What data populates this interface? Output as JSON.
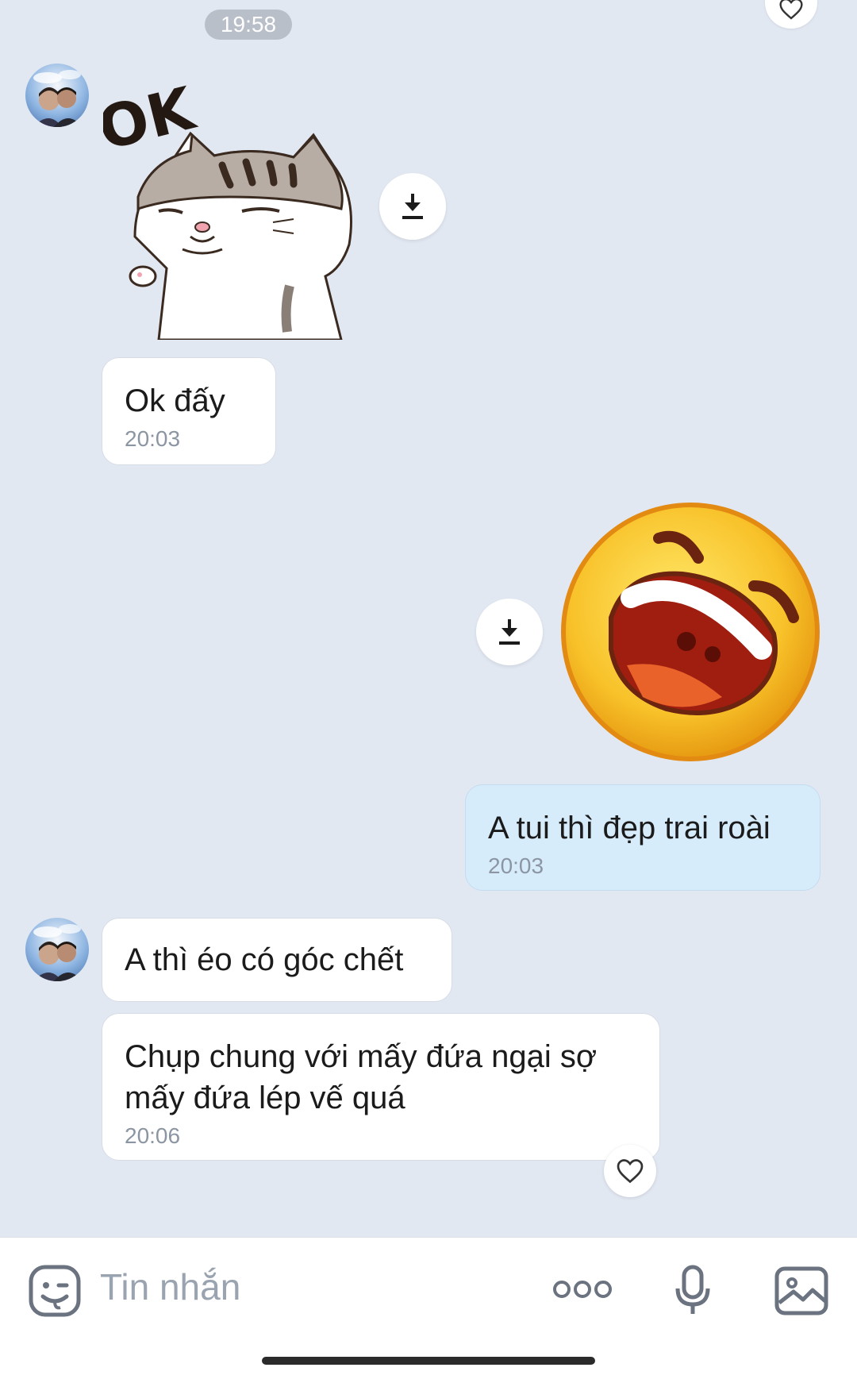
{
  "header": {
    "time_divider": "19:58"
  },
  "messages": [
    {
      "sender": "other",
      "type": "sticker",
      "sticker": "ok-cat-sticker",
      "sticker_text": "OK"
    },
    {
      "sender": "other",
      "type": "text",
      "text": "Ok đấy",
      "time": "20:03"
    },
    {
      "sender": "me",
      "type": "sticker",
      "sticker": "laughing-emoji-sticker"
    },
    {
      "sender": "me",
      "type": "text",
      "text": "A tui thì đẹp trai roài",
      "time": "20:03"
    },
    {
      "sender": "other",
      "type": "text",
      "text": "A thì éo có góc chết"
    },
    {
      "sender": "other",
      "type": "text",
      "text": "Chụp chung với mấy đứa ngại sợ\nmấy đứa lép vế quá",
      "time": "20:06"
    }
  ],
  "input_bar": {
    "placeholder": "Tin nhắn",
    "icons": [
      "emoji-icon",
      "more-icon",
      "microphone-icon",
      "image-icon"
    ]
  },
  "colors": {
    "background": "#e2e8f2",
    "my_bubble": "#d7ecfb",
    "other_bubble": "#ffffff",
    "timestamp": "#8c96a3"
  }
}
